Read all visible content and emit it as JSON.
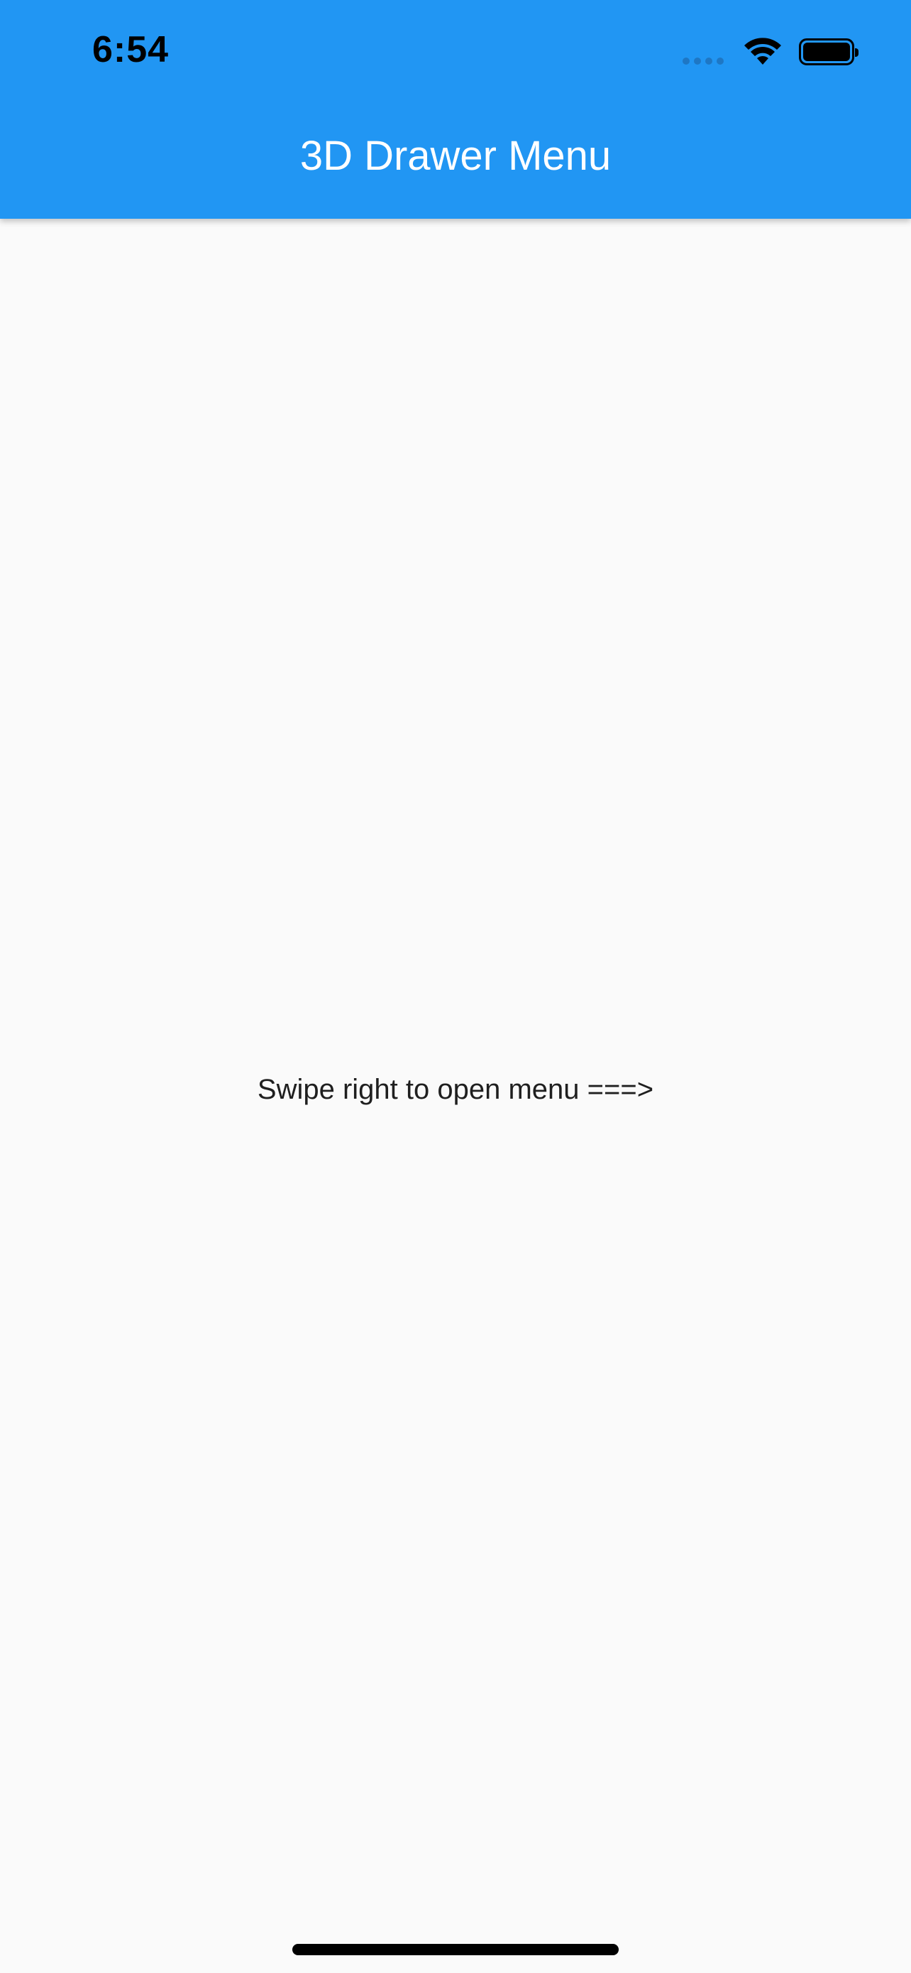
{
  "status_bar": {
    "time": "6:54",
    "icons": [
      "cellular-signal-icon",
      "wifi-icon",
      "battery-icon"
    ]
  },
  "app_bar": {
    "title": "3D Drawer Menu",
    "background_color": "#2196f3",
    "title_color": "#ffffff"
  },
  "body": {
    "hint": "Swipe right to open menu ===>",
    "background_color": "#fafafa"
  }
}
